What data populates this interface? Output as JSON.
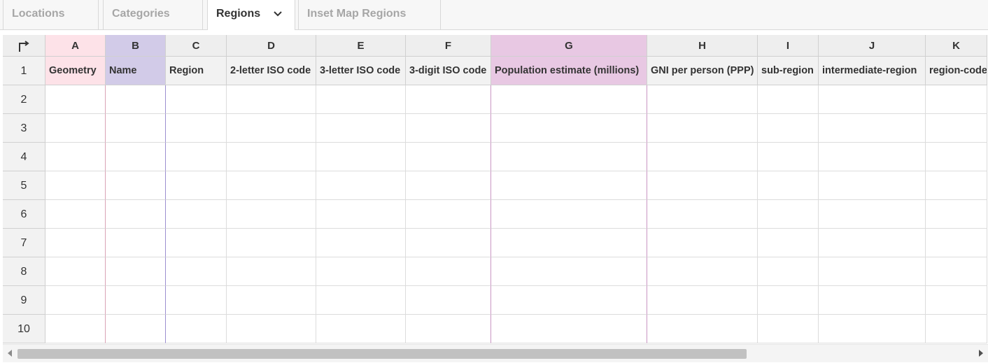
{
  "tabs": [
    {
      "label": "Locations",
      "active": false
    },
    {
      "label": "Categories",
      "active": false
    },
    {
      "label": "Regions",
      "active": true
    },
    {
      "label": "Inset Map Regions",
      "active": false
    }
  ],
  "columns": [
    "A",
    "B",
    "C",
    "D",
    "E",
    "F",
    "G",
    "H",
    "I",
    "J",
    "K"
  ],
  "headers": [
    "Geometry",
    "Name",
    "Region",
    "2-letter ISO code",
    "3-letter ISO code",
    "3-digit ISO code",
    "Population estimate (millions)",
    "GNI per person (PPP)",
    "sub-region",
    "intermediate-region",
    "region-code"
  ],
  "rows": [
    "1",
    "2",
    "3",
    "4",
    "5",
    "6",
    "7",
    "8",
    "9",
    "10"
  ],
  "column_highlights": {
    "A": "#fde2e8",
    "B": "#d2cbe8",
    "G": "#e8c8e3"
  },
  "icons": {
    "corner": "swap-corner-arrow-icon",
    "tab_menu": "chevron-down-icon"
  }
}
